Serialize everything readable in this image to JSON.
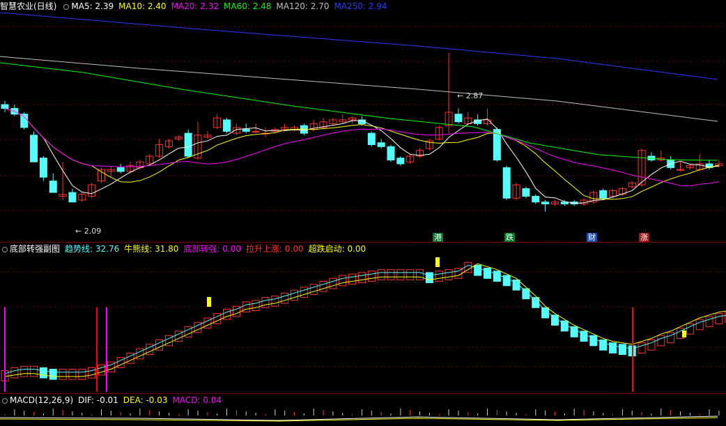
{
  "main_header": {
    "title": "智慧农业(日线)",
    "ma5": "MA5: 2.39",
    "ma10": "MA10: 2.40",
    "ma20": "MA20: 2.32",
    "ma60": "MA60: 2.48",
    "ma120": "MA120: 2.70",
    "ma250": "MA250: 2.94"
  },
  "price_labels": {
    "high": "2.87",
    "low": "2.09"
  },
  "event_markers": [
    {
      "text": "港",
      "color": "#0a7a2a"
    },
    {
      "text": "跌",
      "color": "#0a7a2a"
    },
    {
      "text": "财",
      "color": "#1a4fb0"
    },
    {
      "text": "涨",
      "color": "#a01818"
    }
  ],
  "sub_header": {
    "title": "底部转强副图",
    "trend": "趋势线: 32.76",
    "bull": "牛熊线: 31.80",
    "bottom": "底部转强: 0.00",
    "rise": "拉升上涨: 0.00",
    "launch": "超跌启动: 0.00"
  },
  "macd_header": {
    "title": "MACD(12,26,9)",
    "dif": "DIF: -0.01",
    "dea": "DEA: -0.03",
    "macd": "MACD: 0.04"
  },
  "colors": {
    "up": "#ff3232",
    "down": "#54fcfc",
    "ma5": "#ffffff",
    "ma10": "#ffff00",
    "ma20": "#ff00ff",
    "ma60": "#00ff00",
    "ma120": "#c0c0c0",
    "ma250": "#0000ff",
    "grid": "#7a0000"
  }
}
